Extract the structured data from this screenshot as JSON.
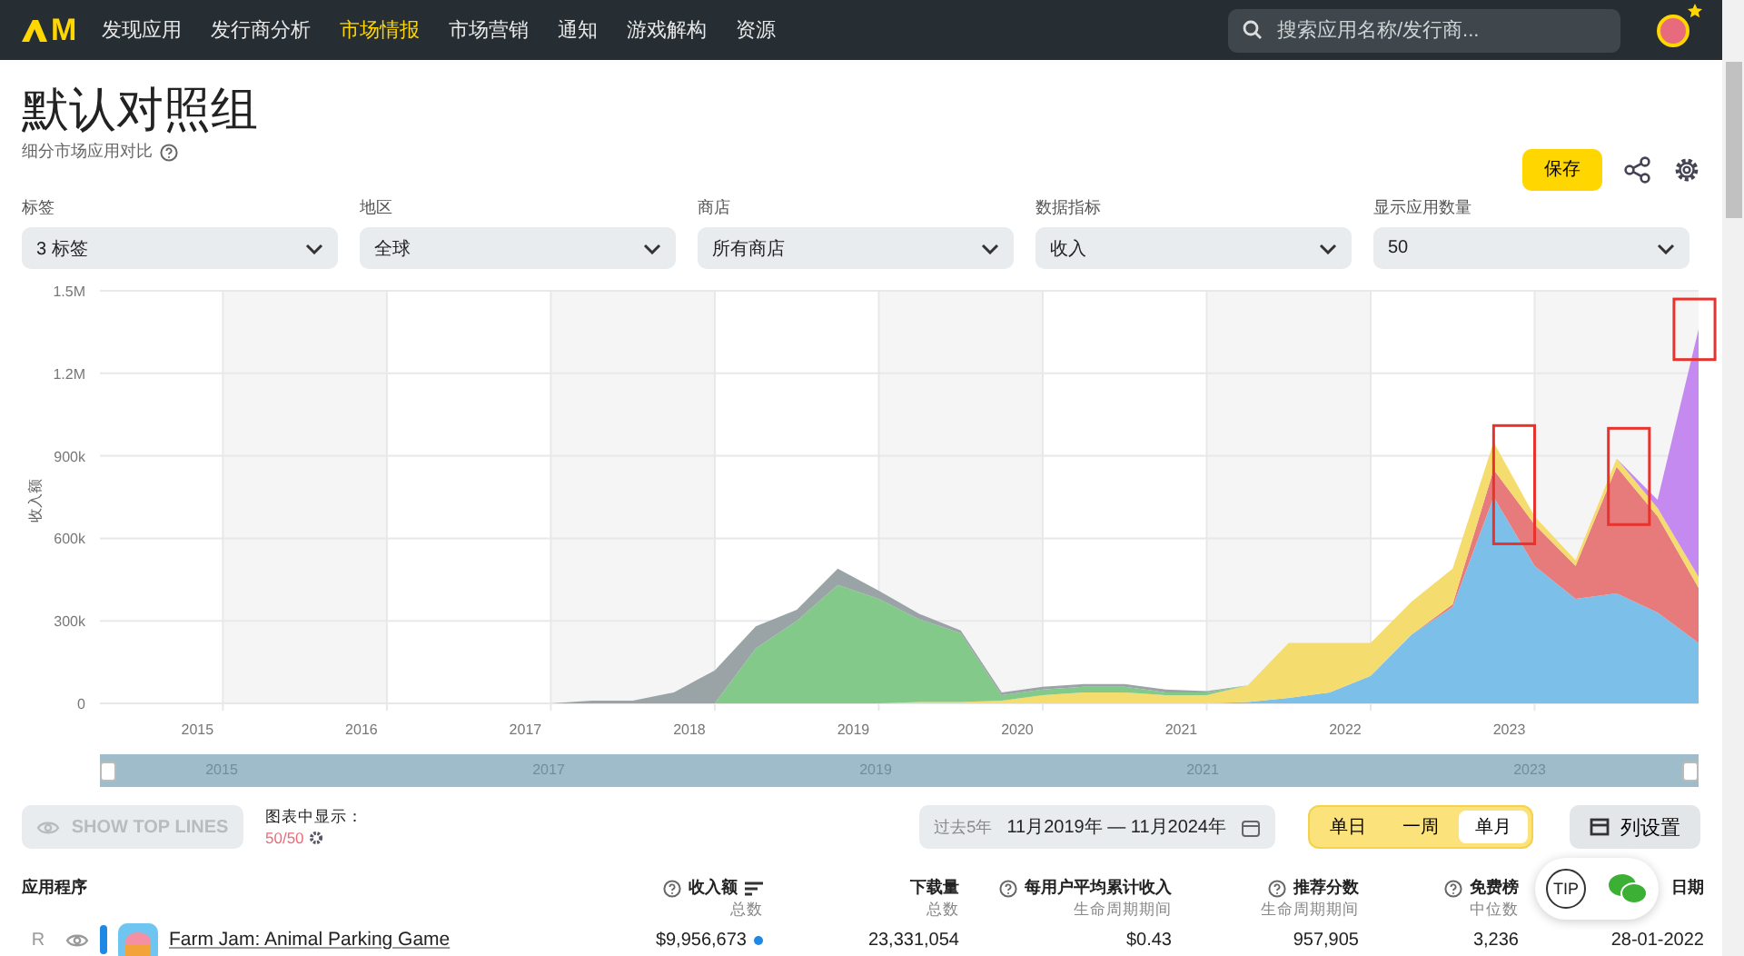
{
  "topbar": {
    "logo_text": "M",
    "nav": [
      {
        "label": "发现应用",
        "selected": false
      },
      {
        "label": "发行商分析",
        "selected": false
      },
      {
        "label": "市场情报",
        "selected": true
      },
      {
        "label": "市场营销",
        "selected": false
      },
      {
        "label": "通知",
        "selected": false
      },
      {
        "label": "游戏解构",
        "selected": false
      },
      {
        "label": "资源",
        "selected": false
      }
    ],
    "search": {
      "placeholder": "搜索应用名称/发行商..."
    }
  },
  "header": {
    "title": "默认对照组",
    "subtitle": "细分市场应用对比",
    "save": "保存"
  },
  "filters": [
    {
      "label": "标签",
      "value": "3 标签"
    },
    {
      "label": "地区",
      "value": "全球"
    },
    {
      "label": "商店",
      "value": "所有商店"
    },
    {
      "label": "数据指标",
      "value": "收入"
    },
    {
      "label": "显示应用数量",
      "value": "50"
    }
  ],
  "chart": {
    "y_label": "收入额",
    "y_ticks": [
      "1.5M",
      "1.2M",
      "900k",
      "600k",
      "300k",
      "0"
    ],
    "x_ticks": [
      "2015",
      "2016",
      "2017",
      "2018",
      "2019",
      "2020",
      "2021",
      "2022",
      "2023"
    ],
    "navigator": [
      "2015",
      "2017",
      "2019",
      "2021",
      "2023"
    ]
  },
  "controls": {
    "top_lines": "SHOW TOP LINES",
    "shown_label": "图表中显示：",
    "shown_count": "50/50",
    "range_label": "过去5年",
    "range": "11月2019年 — 11月2024年",
    "granularity": [
      {
        "label": "单日",
        "selected": false
      },
      {
        "label": "一周",
        "selected": false
      },
      {
        "label": "单月",
        "selected": true
      }
    ],
    "columns": "列设置"
  },
  "table": {
    "columns": [
      {
        "title": "应用程序",
        "help": false
      },
      {
        "title": "收入额",
        "sub": "总数",
        "help": true
      },
      {
        "title": "下载量",
        "sub": "总数",
        "help": false
      },
      {
        "title": "每用户平均累计收入",
        "sub": "生命周期期间",
        "help": true
      },
      {
        "title": "推荐分数",
        "sub": "生命周期期间",
        "help": true
      },
      {
        "title": "免费榜",
        "sub": "中位数",
        "help": true
      },
      {
        "title": "日期",
        "help": false
      }
    ],
    "rows": [
      {
        "rank": "R",
        "cells": [
          "Farm Jam: Animal Parking Game",
          "$9,956,673",
          "23,331,054",
          "$0.43",
          "957,905",
          "3,236",
          "28-01-2022"
        ]
      }
    ]
  },
  "widget": {
    "tip": "TIP"
  }
}
